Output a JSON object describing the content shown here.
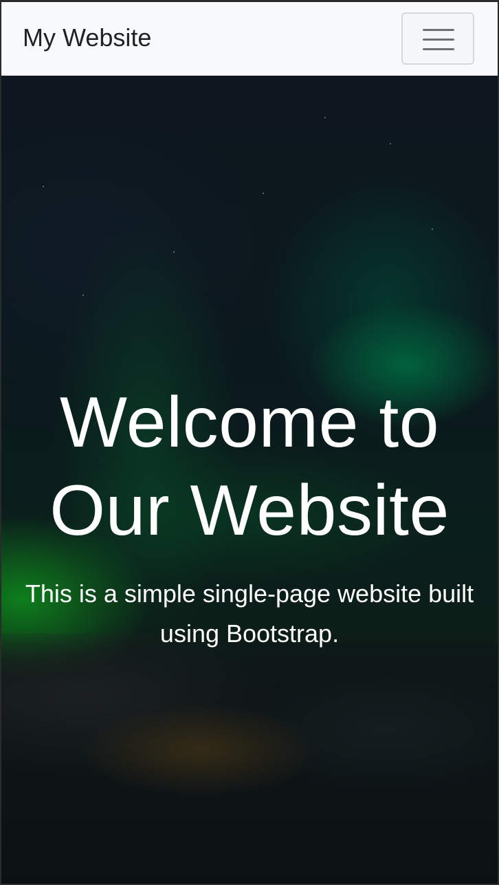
{
  "navbar": {
    "brand": "My Website",
    "menu_toggle_icon": "hamburger-menu-icon"
  },
  "hero": {
    "title": "Welcome to Our Website",
    "lead": "This is a simple single-page website built using Bootstrap.",
    "background": "aurora-night-sky-image"
  },
  "colors": {
    "navbar_bg": "#f8f9fa",
    "brand_text": "#1f2124",
    "hero_text": "#ffffff",
    "toggler_border": "#d6d8db",
    "toggler_bars": "#6c6f73"
  }
}
